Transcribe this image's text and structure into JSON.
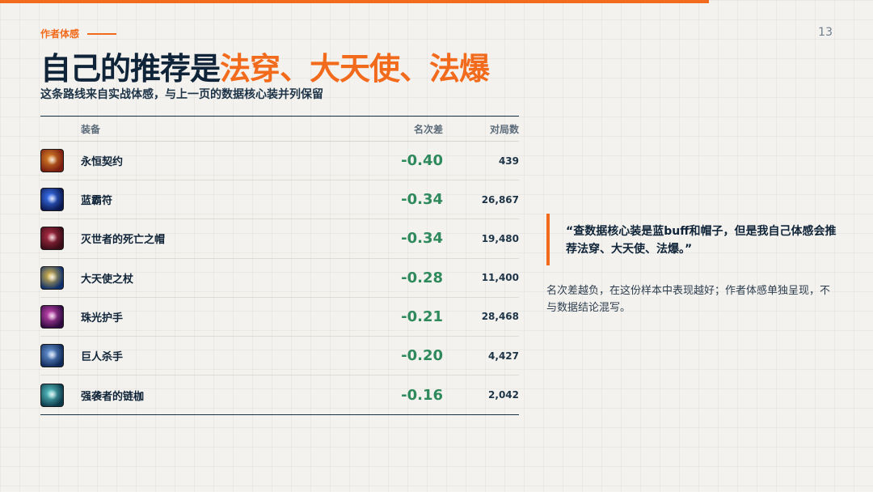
{
  "page": {
    "number": "13"
  },
  "header": {
    "kicker": "作者体感",
    "title_plain": "自己的推荐是",
    "title_accent": "法穿、大天使、法爆",
    "subtitle": "这条路线来自实战体感，与上一页的数据核心装并列保留"
  },
  "table": {
    "columns": {
      "item": "装备",
      "rank_diff": "名次差",
      "games": "对局数"
    },
    "rows": [
      {
        "icon": "eternal-pact-icon",
        "color_a": "#7a1c10",
        "color_b": "#e08a2a",
        "name": "永恒契约",
        "rank_diff": "-0.40",
        "games": "439"
      },
      {
        "icon": "blue-buff-icon",
        "color_a": "#0b1850",
        "color_b": "#3f7bff",
        "name": "蓝霸符",
        "rank_diff": "-0.34",
        "games": "26,867"
      },
      {
        "icon": "rabadon-deathcap-icon",
        "color_a": "#3a0c16",
        "color_b": "#b8304a",
        "name": "灭世者的死亡之帽",
        "rank_diff": "-0.34",
        "games": "19,480"
      },
      {
        "icon": "archangel-staff-icon",
        "color_a": "#0d2f6b",
        "color_b": "#e6c04a",
        "name": "大天使之杖",
        "rank_diff": "-0.28",
        "games": "11,400"
      },
      {
        "icon": "jeweled-gauntlet-icon",
        "color_a": "#2e0a40",
        "color_b": "#d24ab8",
        "name": "珠光护手",
        "rank_diff": "-0.21",
        "games": "28,468"
      },
      {
        "icon": "giant-slayer-icon",
        "color_a": "#102a5a",
        "color_b": "#6fa0e0",
        "name": "巨人杀手",
        "rank_diff": "-0.20",
        "games": "4,427"
      },
      {
        "icon": "ionic-spark-icon",
        "color_a": "#0d3a4a",
        "color_b": "#5fd0d0",
        "name": "强袭者的链枷",
        "rank_diff": "-0.16",
        "games": "2,042"
      }
    ]
  },
  "quote": {
    "text": "“查数据核心装是蓝buff和帽子，但是我自己体感会推荐法穿、大天使、法爆。”"
  },
  "note": {
    "text": "名次差越负，在这份样本中表现越好；作者体感单独呈现，不与数据结论混写。"
  },
  "colors": {
    "accent": "#f26b1d",
    "navy": "#0f2438",
    "positive": "#2e8a5c"
  }
}
